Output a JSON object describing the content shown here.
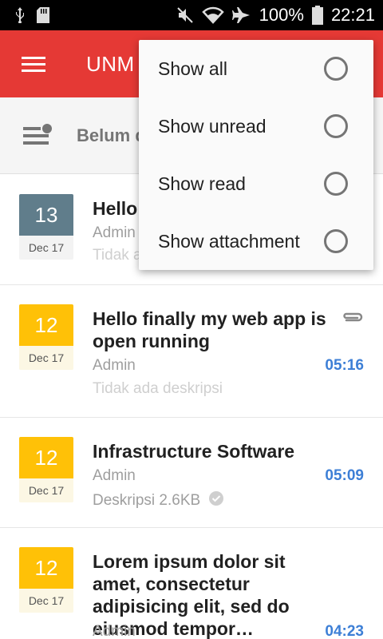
{
  "status_bar": {
    "battery": "100%",
    "time": "22:21",
    "icons": [
      "usb-icon",
      "sd-card-icon",
      "mute-icon",
      "wifi-icon",
      "airplane-icon",
      "battery-icon"
    ]
  },
  "app_bar": {
    "title": "UNM",
    "menu_icon": "hamburger-menu-icon",
    "color": "#e53935"
  },
  "filter": {
    "label": "Belum d"
  },
  "messages": [
    {
      "day": "13",
      "month": "Dec 17",
      "date_color": "#607d8b",
      "title": "Hello",
      "author": "Admin",
      "description": "Tidak a"
    },
    {
      "day": "12",
      "month": "Dec 17",
      "date_color": "#ffc107",
      "title": "Hello finally my web app is open running",
      "author": "Admin",
      "time": "05:16",
      "description": "Tidak ada deskripsi",
      "has_attachment": true
    },
    {
      "day": "12",
      "month": "Dec 17",
      "date_color": "#ffc107",
      "title": "Infrastructure Software",
      "author": "Admin",
      "time": "05:09",
      "description": "Deskripsi 2.6KB",
      "has_check": true
    },
    {
      "day": "12",
      "month": "Dec 17",
      "date_color": "#ffc107",
      "title": "Lorem ipsum dolor sit amet, consectetur adipisicing elit, sed do eiusmod tempor…",
      "author": "Admin",
      "time": "04:23"
    }
  ],
  "popup_menu": {
    "items": [
      {
        "label": "Show all",
        "selected": false
      },
      {
        "label": "Show unread",
        "selected": false
      },
      {
        "label": "Show read",
        "selected": false
      },
      {
        "label": "Show attachment",
        "selected": false
      }
    ]
  },
  "colors": {
    "accent": "#e53935",
    "time_blue": "#3d7fd6",
    "unread_date": "#ffc107",
    "read_date": "#607d8b"
  }
}
